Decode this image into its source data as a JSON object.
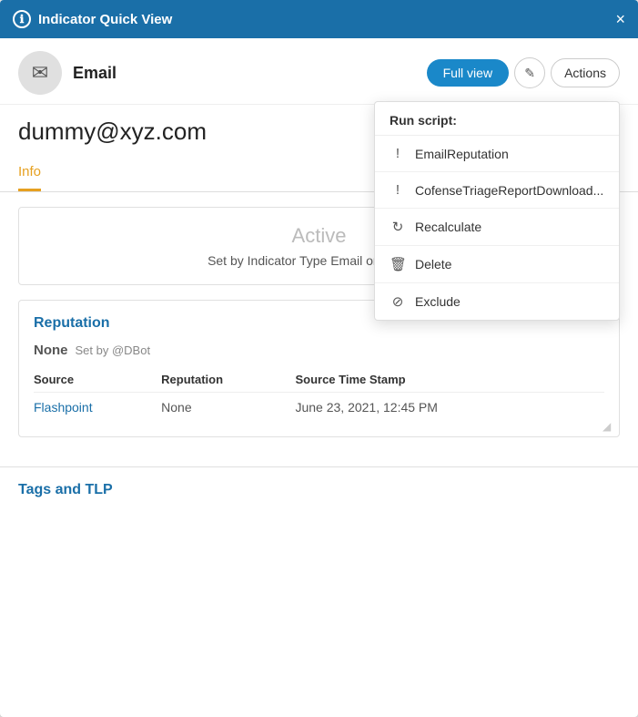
{
  "header": {
    "icon": "ℹ",
    "title": "Indicator Quick View",
    "close_label": "×"
  },
  "indicator": {
    "type": "Email",
    "email_address": "dummy@xyz.com"
  },
  "toolbar": {
    "fullview_label": "Full view",
    "edit_icon": "✎",
    "actions_label": "Actions"
  },
  "tabs": [
    {
      "label": "Info",
      "active": true
    }
  ],
  "status": {
    "text": "Active",
    "sub_text": "Set by Indicator Type Email on Ju... PM"
  },
  "dropdown": {
    "run_script_label": "Run script:",
    "items": [
      {
        "icon": "!",
        "label": "EmailReputation"
      },
      {
        "icon": "!",
        "label": "CofenseTriageReportDownload..."
      },
      {
        "icon": "↻",
        "label": "Recalculate"
      },
      {
        "icon": "🗑",
        "label": "Delete"
      },
      {
        "icon": "⊘",
        "label": "Exclude"
      }
    ]
  },
  "reputation": {
    "section_title": "Reputation",
    "value": "None",
    "set_by": "Set by @DBot",
    "table": {
      "headers": [
        "Source",
        "Reputation",
        "Source Time Stamp"
      ],
      "rows": [
        {
          "source": "Flashpoint",
          "reputation": "None",
          "timestamp": "June 23, 2021, 12:45 PM"
        }
      ]
    }
  },
  "tags_section": {
    "title": "Tags and TLP"
  }
}
